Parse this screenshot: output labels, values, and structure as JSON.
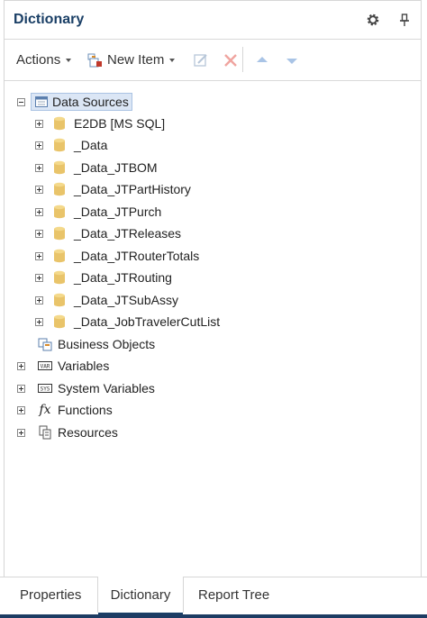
{
  "panel": {
    "title": "Dictionary"
  },
  "toolbar": {
    "actions_label": "Actions",
    "new_item_label": "New Item"
  },
  "tree": {
    "data_sources": {
      "label": "Data Sources",
      "children": [
        "E2DB [MS SQL]",
        "_Data",
        "_Data_JTBOM",
        "_Data_JTPartHistory",
        "_Data_JTPurch",
        "_Data_JTReleases",
        "_Data_JTRouterTotals",
        "_Data_JTRouting",
        "_Data_JTSubAssy",
        "_Data_JobTravelerCutList"
      ]
    },
    "business_objects": "Business Objects",
    "variables": "Variables",
    "system_variables": "System Variables",
    "functions": "Functions",
    "resources": "Resources"
  },
  "tabs": {
    "properties": "Properties",
    "dictionary": "Dictionary",
    "report_tree": "Report Tree"
  },
  "colors": {
    "title": "#1a3f66",
    "selection": "#dbe6f5",
    "database_icon": "#e9c46a",
    "bottom_strip": "#1d3c63"
  }
}
